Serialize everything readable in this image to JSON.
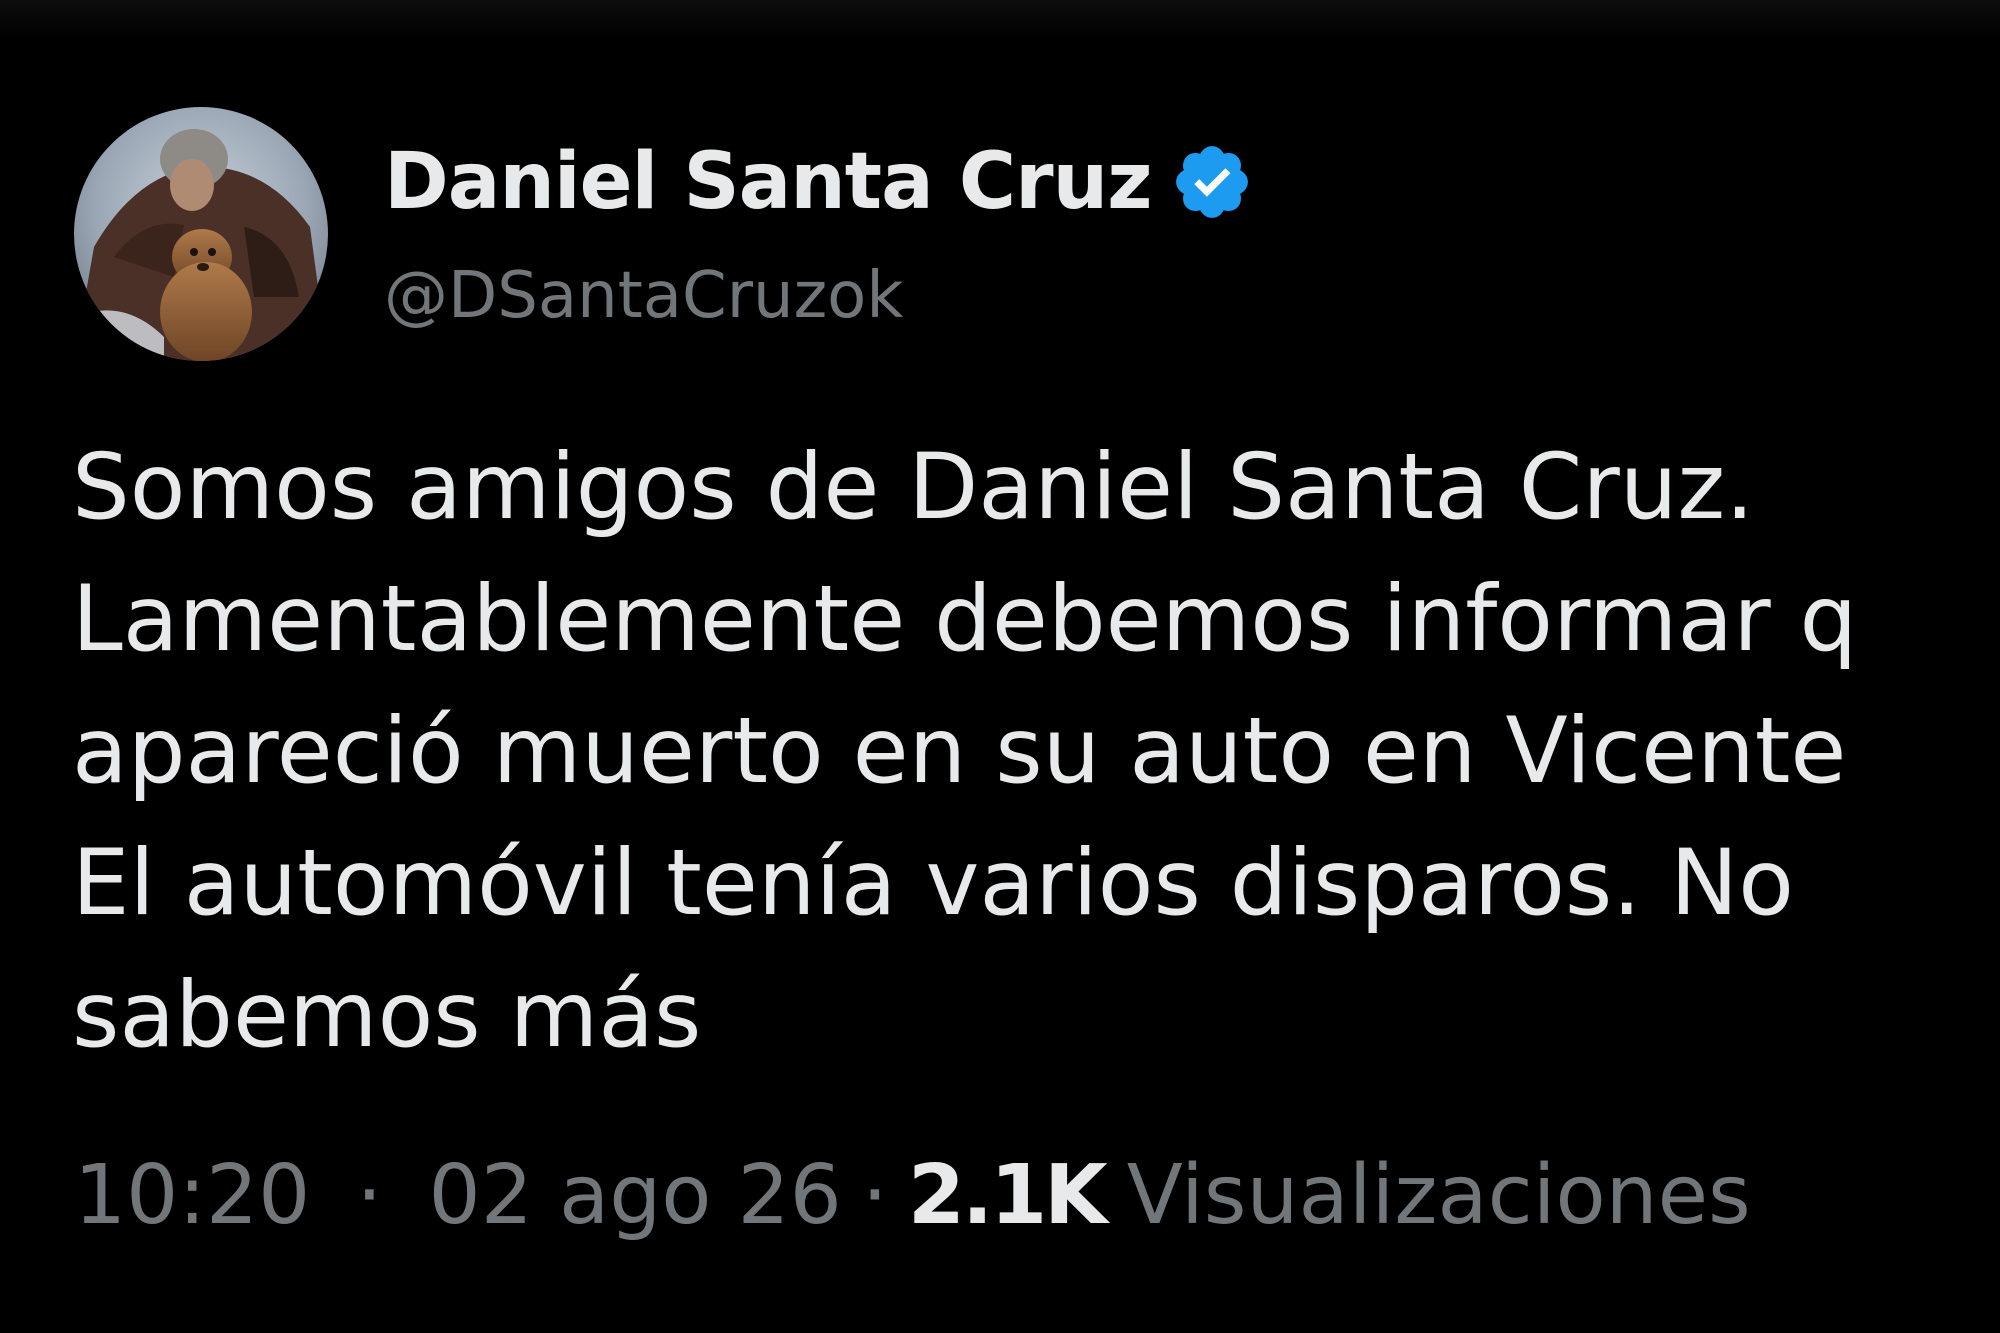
{
  "tweet": {
    "author": {
      "display_name": "Daniel Santa Cruz",
      "handle": "@DSantaCruzok",
      "verified": true,
      "verified_icon": "verified-badge-icon",
      "verified_color": "#1d9bf0",
      "avatar_icon": "profile-photo"
    },
    "text_lines": [
      "Somos amigos de Daniel Santa Cruz.",
      "Lamentablemente debemos informar q",
      "apareció muerto en su auto en Vicente",
      "El automóvil tenía varios disparos. No",
      "sabemos más"
    ],
    "meta": {
      "time": "10:20",
      "separator": "·",
      "date": "02 ago 26",
      "views_count": "2.1K",
      "views_label": "Visualizaciones"
    }
  },
  "colors": {
    "background": "#000000",
    "primary_text": "#e7e9ea",
    "secondary_text": "#71767b",
    "accent": "#1d9bf0"
  }
}
